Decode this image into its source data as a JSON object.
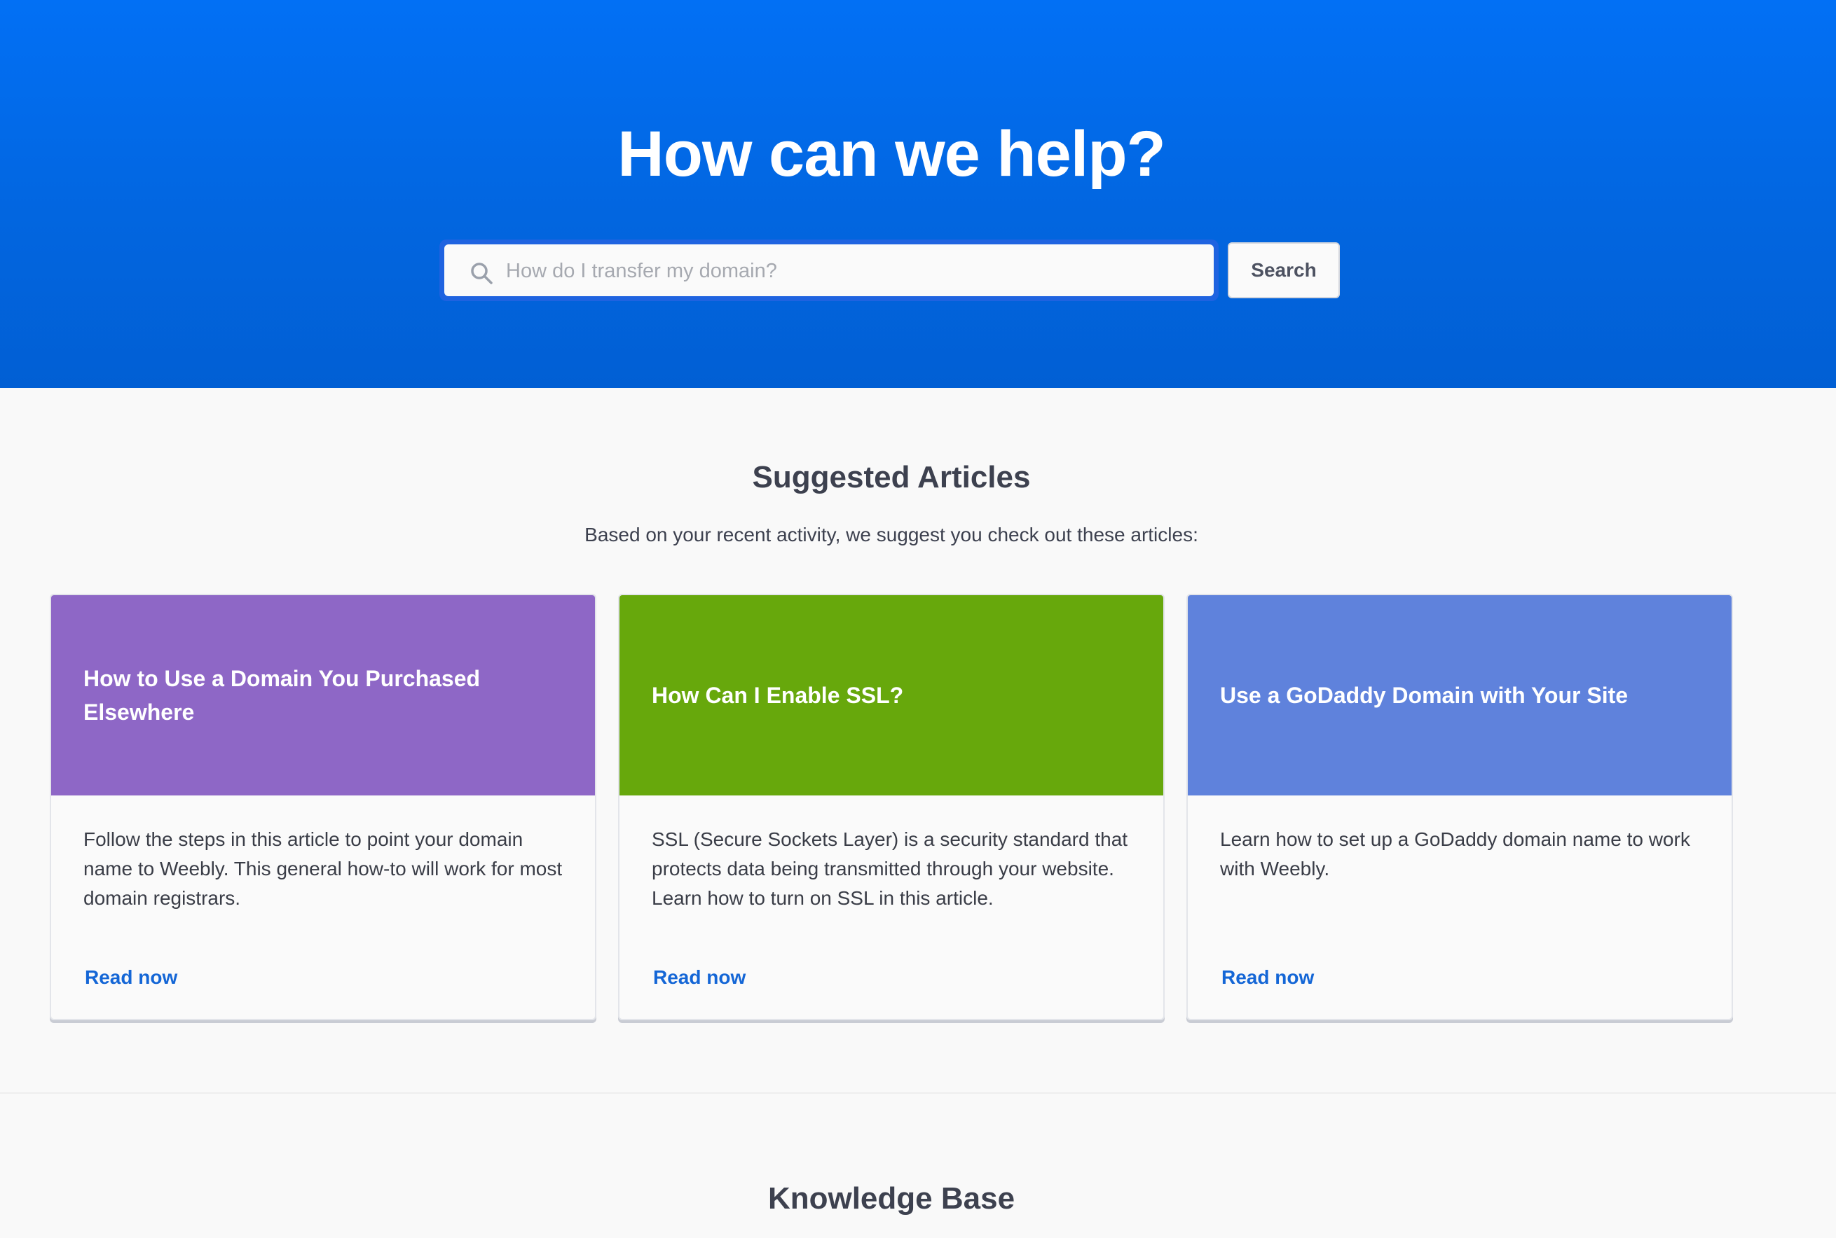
{
  "hero": {
    "title": "How can we help?",
    "search_placeholder": "How do I transfer my domain?",
    "search_button": "Search"
  },
  "suggested": {
    "title": "Suggested Articles",
    "subtitle": "Based on your recent activity, we suggest you check out these articles:",
    "cards": [
      {
        "title": "How to Use a Domain You Purchased Elsewhere",
        "description": "Follow the steps in this article to point your domain name to Weebly. This general how-to will work for most domain registrars.",
        "link": "Read now",
        "color": "#8e67c6"
      },
      {
        "title": "How Can I Enable SSL?",
        "description": "SSL (Secure Sockets Layer) is a security standard that protects data being transmitted through your website. Learn how to turn on SSL in this article.",
        "link": "Read now",
        "color": "#67a80c"
      },
      {
        "title": "Use a GoDaddy Domain with Your Site",
        "description": "Learn how to set up a GoDaddy domain name to work with Weebly.",
        "link": "Read now",
        "color": "#5f82dc"
      }
    ]
  },
  "knowledge_base": {
    "title": "Knowledge Base"
  },
  "colors": {
    "hero_blue": "#0270f5",
    "link_blue": "#1466d6"
  },
  "icons": {
    "search": "search-icon"
  }
}
